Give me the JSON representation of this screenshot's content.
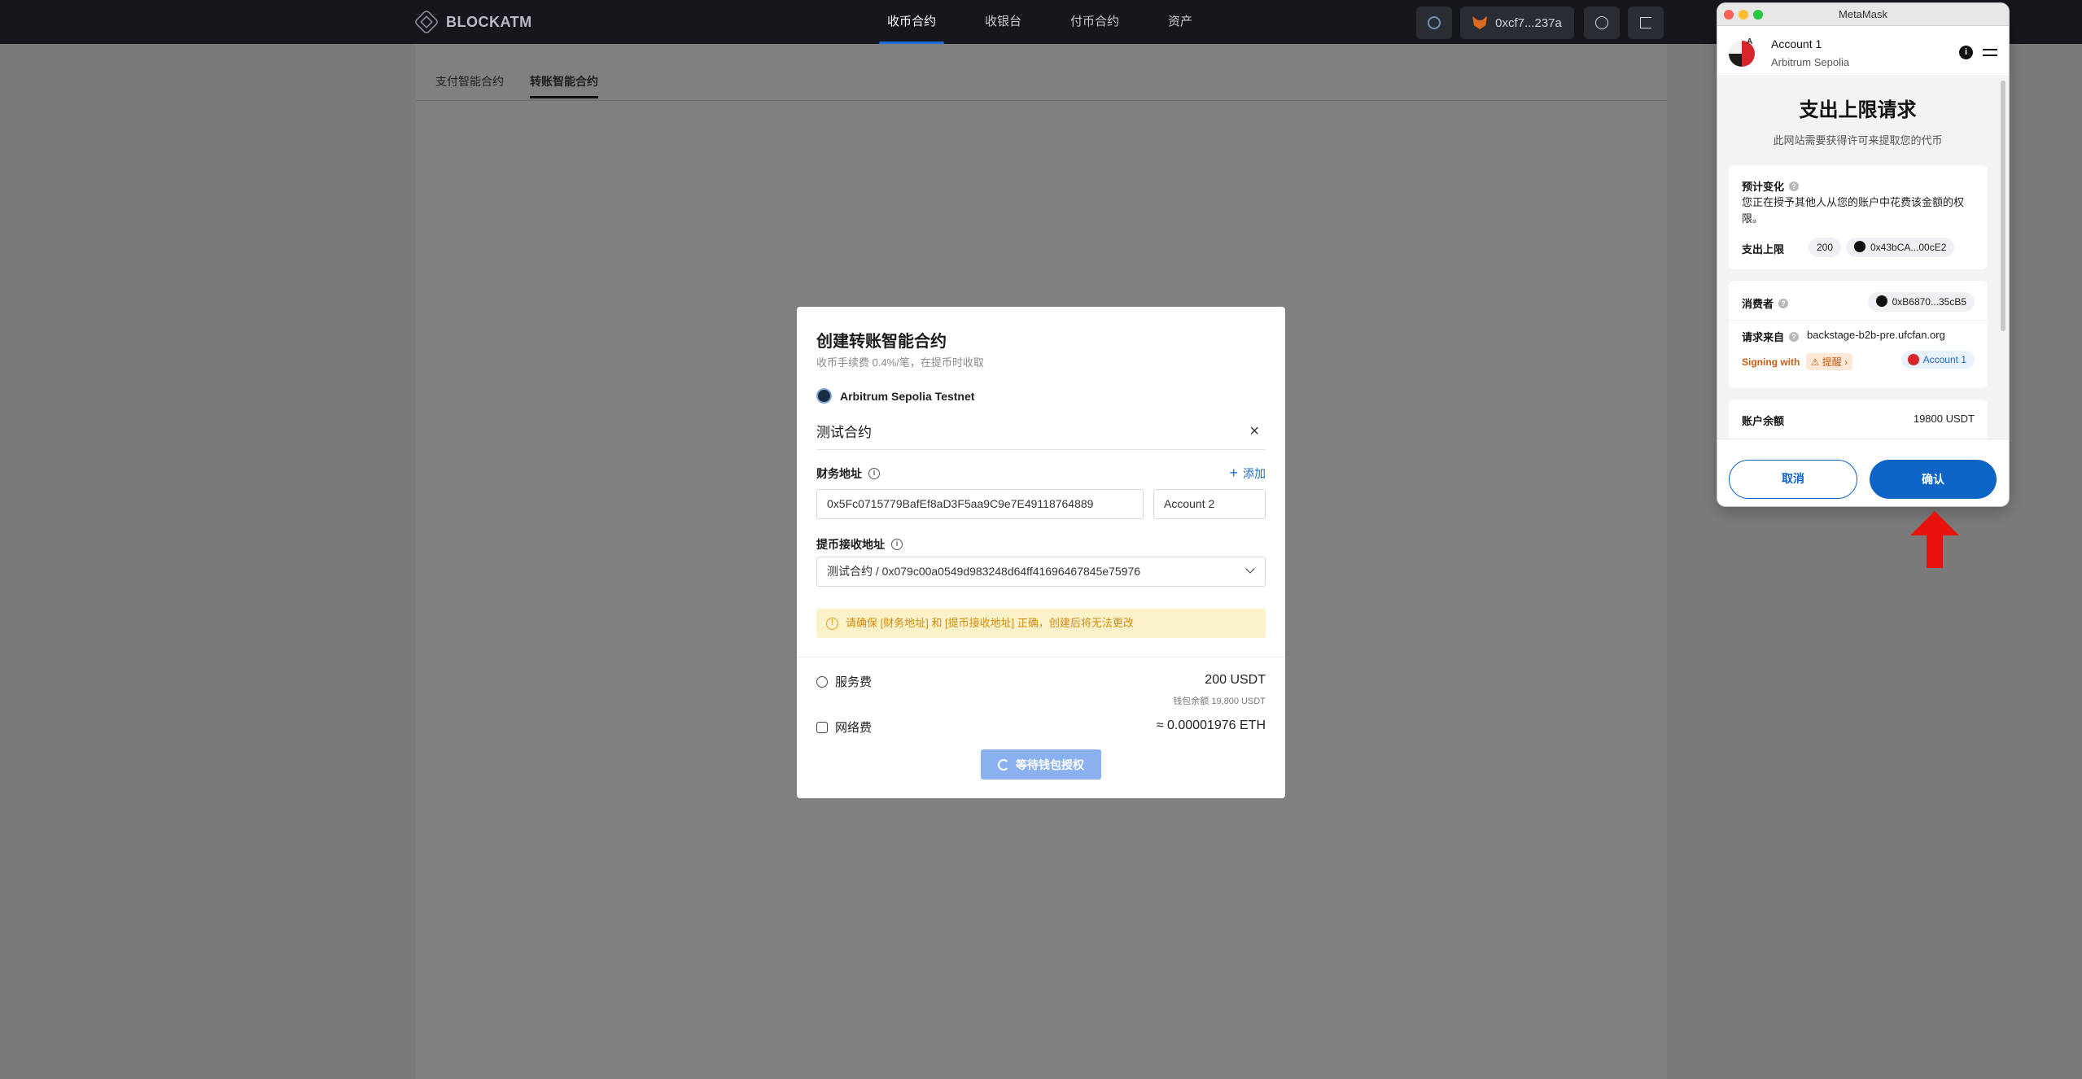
{
  "app": {
    "brand": "BLOCKATM"
  },
  "nav": [
    "收币合约",
    "收银台",
    "付币合约",
    "资产"
  ],
  "topbar": {
    "wallet": "0xcf7...237a"
  },
  "subtabs": [
    "支付智能合约",
    "转账智能合约"
  ],
  "modal": {
    "title": "创建转账智能合约",
    "subtitle": "收币手续费 0.4%/笔，在提币时收取",
    "network": "Arbitrum Sepolia Testnet",
    "contract_name": "测试合约",
    "finance_label": "财务地址",
    "add_label": "添加",
    "finance_address": "0x5Fc0715779BafEf8aD3F5aa9C9e7E49118764889",
    "finance_account": "Account 2",
    "withdraw_label": "提币接收地址",
    "withdraw_value": "测试合约 / 0x079c00a0549d983248d64ff41696467845e75976",
    "warning": "请确保 [财务地址] 和 [提币接收地址] 正确，创建后将无法更改",
    "service_fee_label": "服务费",
    "service_fee": "200 USDT",
    "wallet_balance": "钱包余额 19,800 USDT",
    "network_fee_label": "网络费",
    "network_fee": "≈ 0.00001976 ETH",
    "waiting_label": "等待钱包授权"
  },
  "metamask": {
    "window_title": "MetaMask",
    "account": "Account 1",
    "network": "Arbitrum Sepolia",
    "avatar_badge": "A",
    "heading": "支出上限请求",
    "subheading": "此网站需要获得许可来提取您的代币",
    "estimated_label": "预计变化",
    "estimated_text": "您正在授予其他人从您的账户中花费该金额的权限。",
    "limit_label": "支出上限",
    "limit_value": "200",
    "limit_token": "0x43bCA...00cE2",
    "spender_label": "消费者",
    "spender": "0xB6870...35cB5",
    "origin_label": "请求来自",
    "origin": "backstage-b2b-pre.ufcfan.org",
    "signing_label": "Signing with",
    "remind_label": "提醒",
    "signing_account": "Account 1",
    "balance_label": "账户余额",
    "balance": "19800 USDT",
    "cancel": "取消",
    "confirm": "确认"
  },
  "colors": {
    "accent": "#0b64c6",
    "warning": "#d28a0c",
    "arrow": "#e8120c"
  }
}
